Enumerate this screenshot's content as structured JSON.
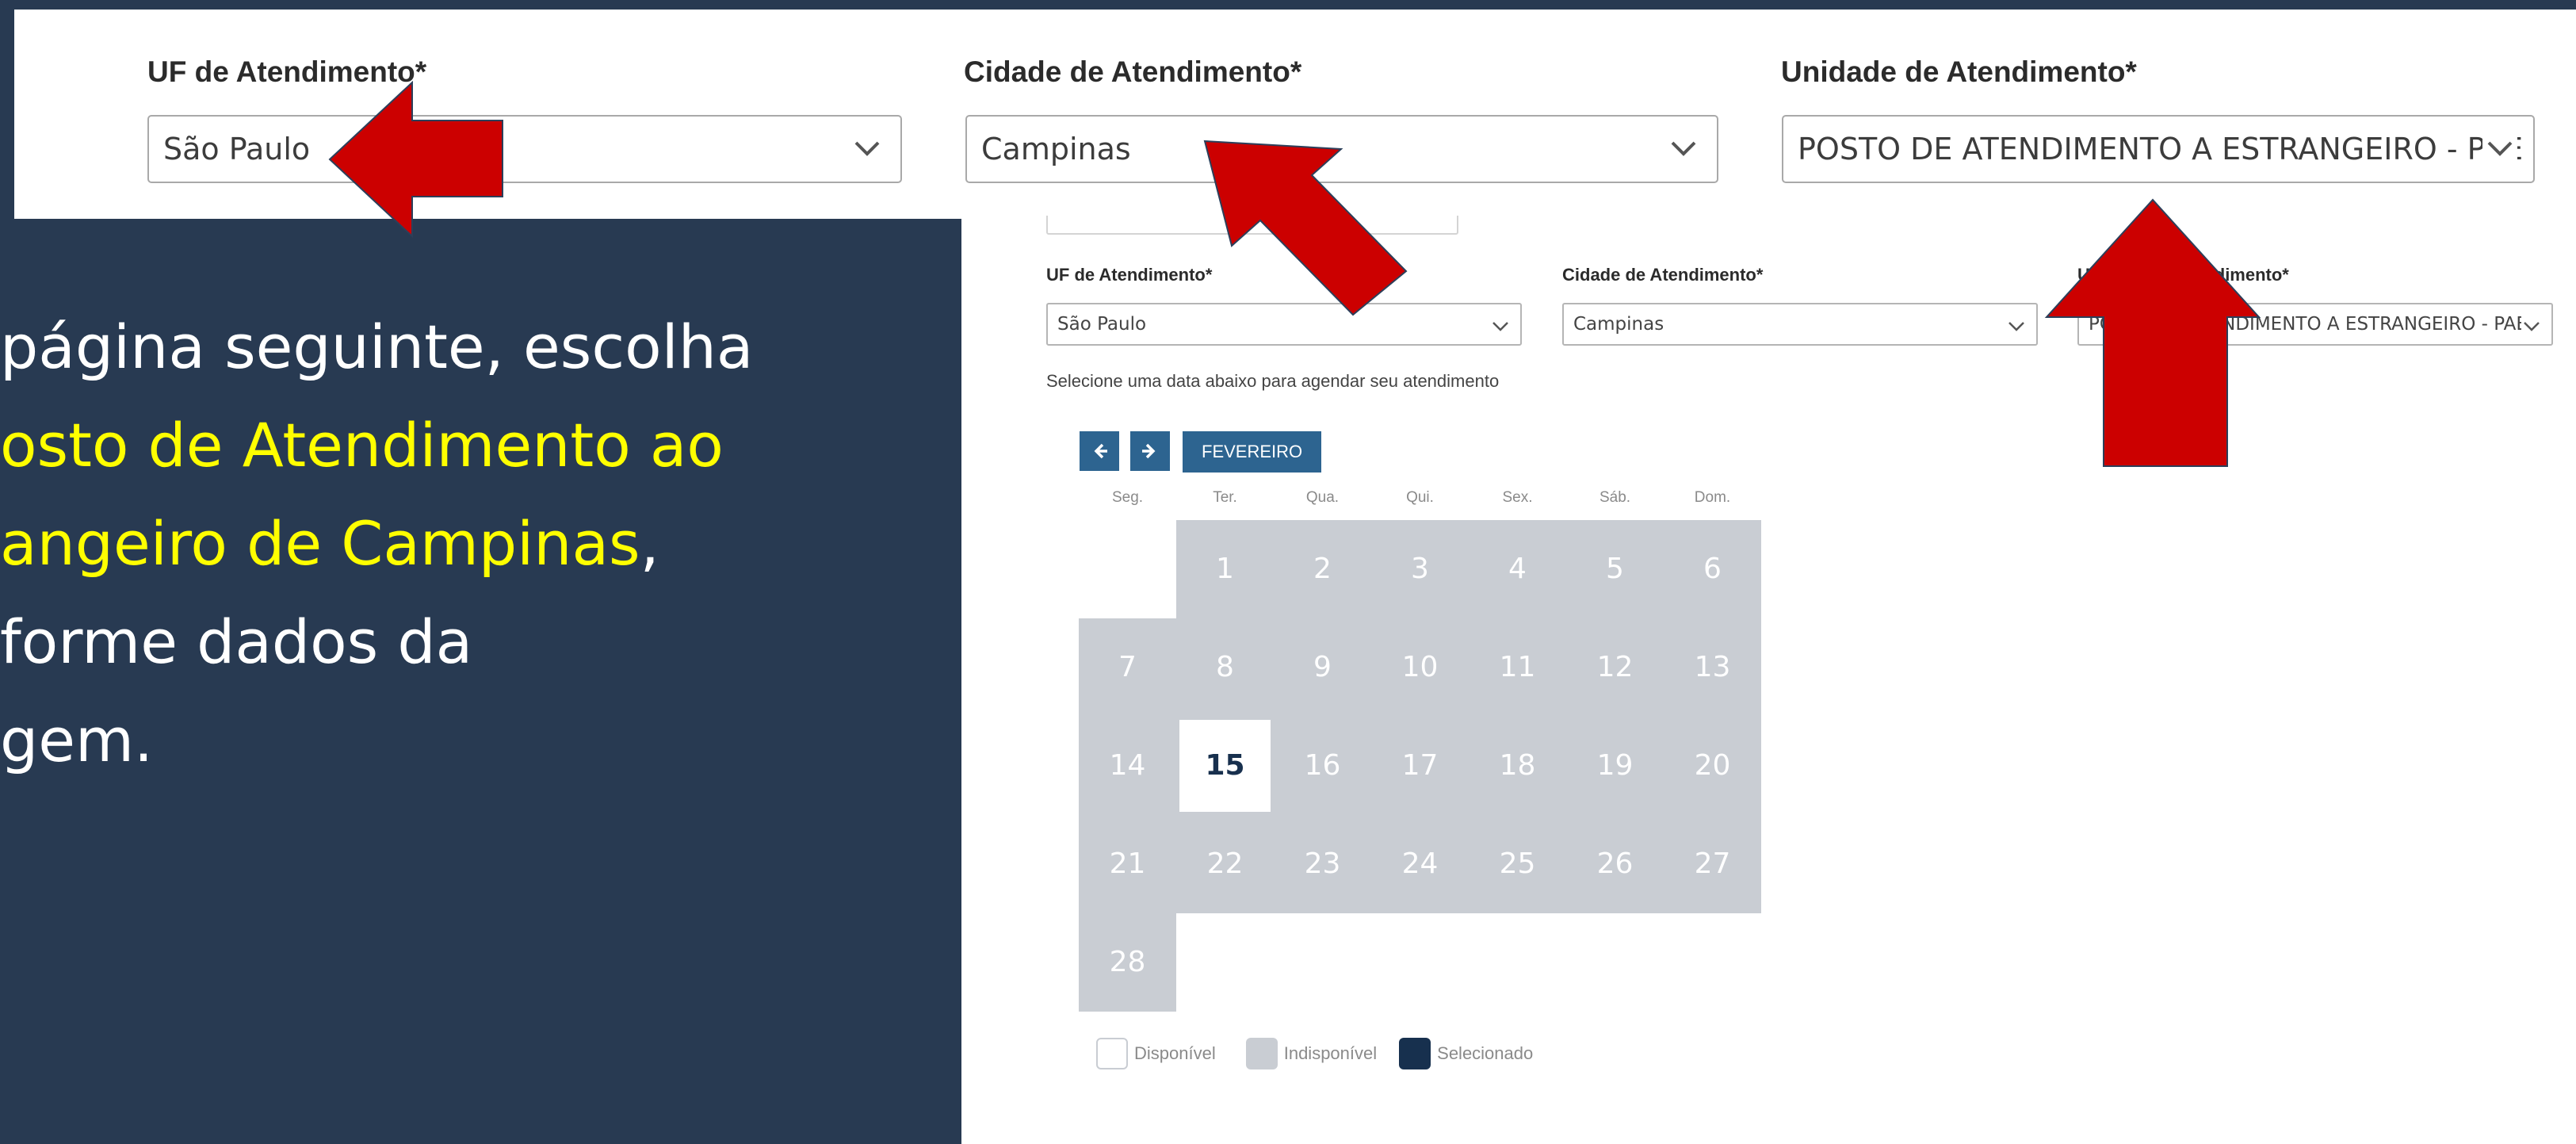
{
  "zoom_panel": {
    "uf": {
      "label": "UF de Atendimento*",
      "value": "São Paulo"
    },
    "cidade": {
      "label": "Cidade de Atendimento*",
      "value": "Campinas"
    },
    "unidade": {
      "label": "Unidade de Atendimento*",
      "value": "POSTO DE ATENDIMENTO A ESTRANGEIRO - PAE"
    }
  },
  "instruction": {
    "line1": "página seguinte, escolha",
    "line2": "osto de Atendimento ao",
    "line3_yellow": "angeiro de Campinas",
    "line3_rest": ",",
    "line4": "forme dados da",
    "line5": "gem."
  },
  "screenshot": {
    "uf": {
      "label": "UF de Atendimento*",
      "value": "São Paulo"
    },
    "cidade": {
      "label": "Cidade de Atendimento*",
      "value": "Campinas"
    },
    "unidade": {
      "label": "Unidade de Atendimento*",
      "value": "POSTO DE ATENDIMENTO A ESTRANGEIRO - PAE"
    },
    "note": "Selecione uma data abaixo para agendar seu atendimento",
    "calendar": {
      "prev_icon": "arrow-left-icon",
      "next_icon": "arrow-right-icon",
      "month": "FEVEREIRO",
      "weekdays": [
        "Seg.",
        "Ter.",
        "Qua.",
        "Qui.",
        "Sex.",
        "Sáb.",
        "Dom."
      ],
      "days": [
        [
          "",
          "1",
          "2",
          "3",
          "4",
          "5",
          "6"
        ],
        [
          "7",
          "8",
          "9",
          "10",
          "11",
          "12",
          "13"
        ],
        [
          "14",
          "15",
          "16",
          "17",
          "18",
          "19",
          "20"
        ],
        [
          "21",
          "22",
          "23",
          "24",
          "25",
          "26",
          "27"
        ],
        [
          "28",
          "",
          "",
          "",
          "",
          "",
          ""
        ]
      ],
      "available_day": "15"
    },
    "legend": {
      "available": "Disponível",
      "unavailable": "Indisponível",
      "selected": "Selecionado"
    }
  },
  "colors": {
    "background": "#283a52",
    "highlight_text": "#ffff00",
    "arrow": "#cc0000",
    "calendar_unavailable": "#c9cdd3",
    "calendar_selected": "#17304e",
    "button_blue": "#2d6490"
  }
}
